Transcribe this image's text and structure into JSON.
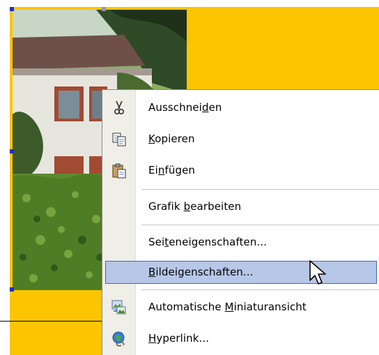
{
  "context_menu": {
    "items": [
      {
        "id": "cut",
        "pre": "Ausschnei",
        "key": "d",
        "post": "en",
        "icon": "scissors-icon"
      },
      {
        "id": "copy",
        "pre": "",
        "key": "K",
        "post": "opieren",
        "icon": "copy-icon"
      },
      {
        "id": "paste",
        "pre": "Ei",
        "key": "n",
        "post": "fügen",
        "icon": "paste-icon"
      },
      {
        "id": "edit-image",
        "pre": "Grafik ",
        "key": "b",
        "post": "earbeiten",
        "icon": ""
      },
      {
        "id": "page-properties",
        "pre": "Sei",
        "key": "t",
        "post": "eneigenschaften...",
        "icon": ""
      },
      {
        "id": "image-properties",
        "pre": "",
        "key": "B",
        "post": "ildeigenschaften...",
        "icon": "",
        "highlighted": true
      },
      {
        "id": "auto-thumbnail",
        "pre": "Automatische ",
        "key": "M",
        "post": "iniaturansicht",
        "icon": "thumbnail-icon"
      },
      {
        "id": "hyperlink",
        "pre": "",
        "key": "H",
        "post": "yperlink...",
        "icon": "hyperlink-globe-icon"
      }
    ]
  },
  "colors": {
    "background": "#fcc500",
    "highlight_fill": "#b6c7e8",
    "highlight_border": "#3c66c4",
    "gutter": "#f0efe7"
  }
}
